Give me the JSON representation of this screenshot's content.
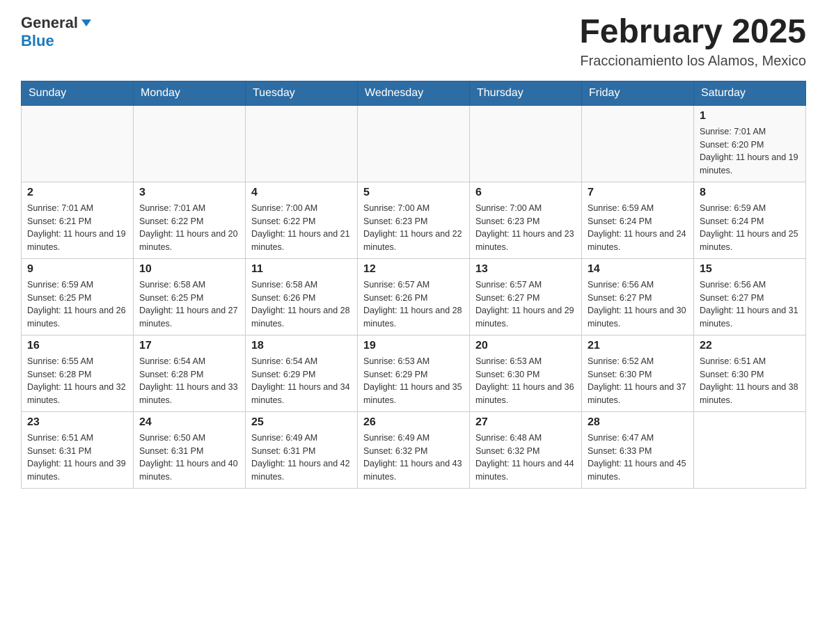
{
  "header": {
    "logo": {
      "general": "General",
      "blue": "Blue"
    },
    "title": "February 2025",
    "subtitle": "Fraccionamiento los Alamos, Mexico"
  },
  "days_of_week": [
    "Sunday",
    "Monday",
    "Tuesday",
    "Wednesday",
    "Thursday",
    "Friday",
    "Saturday"
  ],
  "weeks": [
    [
      {
        "day": "",
        "info": ""
      },
      {
        "day": "",
        "info": ""
      },
      {
        "day": "",
        "info": ""
      },
      {
        "day": "",
        "info": ""
      },
      {
        "day": "",
        "info": ""
      },
      {
        "day": "",
        "info": ""
      },
      {
        "day": "1",
        "info": "Sunrise: 7:01 AM\nSunset: 6:20 PM\nDaylight: 11 hours and 19 minutes."
      }
    ],
    [
      {
        "day": "2",
        "info": "Sunrise: 7:01 AM\nSunset: 6:21 PM\nDaylight: 11 hours and 19 minutes."
      },
      {
        "day": "3",
        "info": "Sunrise: 7:01 AM\nSunset: 6:22 PM\nDaylight: 11 hours and 20 minutes."
      },
      {
        "day": "4",
        "info": "Sunrise: 7:00 AM\nSunset: 6:22 PM\nDaylight: 11 hours and 21 minutes."
      },
      {
        "day": "5",
        "info": "Sunrise: 7:00 AM\nSunset: 6:23 PM\nDaylight: 11 hours and 22 minutes."
      },
      {
        "day": "6",
        "info": "Sunrise: 7:00 AM\nSunset: 6:23 PM\nDaylight: 11 hours and 23 minutes."
      },
      {
        "day": "7",
        "info": "Sunrise: 6:59 AM\nSunset: 6:24 PM\nDaylight: 11 hours and 24 minutes."
      },
      {
        "day": "8",
        "info": "Sunrise: 6:59 AM\nSunset: 6:24 PM\nDaylight: 11 hours and 25 minutes."
      }
    ],
    [
      {
        "day": "9",
        "info": "Sunrise: 6:59 AM\nSunset: 6:25 PM\nDaylight: 11 hours and 26 minutes."
      },
      {
        "day": "10",
        "info": "Sunrise: 6:58 AM\nSunset: 6:25 PM\nDaylight: 11 hours and 27 minutes."
      },
      {
        "day": "11",
        "info": "Sunrise: 6:58 AM\nSunset: 6:26 PM\nDaylight: 11 hours and 28 minutes."
      },
      {
        "day": "12",
        "info": "Sunrise: 6:57 AM\nSunset: 6:26 PM\nDaylight: 11 hours and 28 minutes."
      },
      {
        "day": "13",
        "info": "Sunrise: 6:57 AM\nSunset: 6:27 PM\nDaylight: 11 hours and 29 minutes."
      },
      {
        "day": "14",
        "info": "Sunrise: 6:56 AM\nSunset: 6:27 PM\nDaylight: 11 hours and 30 minutes."
      },
      {
        "day": "15",
        "info": "Sunrise: 6:56 AM\nSunset: 6:27 PM\nDaylight: 11 hours and 31 minutes."
      }
    ],
    [
      {
        "day": "16",
        "info": "Sunrise: 6:55 AM\nSunset: 6:28 PM\nDaylight: 11 hours and 32 minutes."
      },
      {
        "day": "17",
        "info": "Sunrise: 6:54 AM\nSunset: 6:28 PM\nDaylight: 11 hours and 33 minutes."
      },
      {
        "day": "18",
        "info": "Sunrise: 6:54 AM\nSunset: 6:29 PM\nDaylight: 11 hours and 34 minutes."
      },
      {
        "day": "19",
        "info": "Sunrise: 6:53 AM\nSunset: 6:29 PM\nDaylight: 11 hours and 35 minutes."
      },
      {
        "day": "20",
        "info": "Sunrise: 6:53 AM\nSunset: 6:30 PM\nDaylight: 11 hours and 36 minutes."
      },
      {
        "day": "21",
        "info": "Sunrise: 6:52 AM\nSunset: 6:30 PM\nDaylight: 11 hours and 37 minutes."
      },
      {
        "day": "22",
        "info": "Sunrise: 6:51 AM\nSunset: 6:30 PM\nDaylight: 11 hours and 38 minutes."
      }
    ],
    [
      {
        "day": "23",
        "info": "Sunrise: 6:51 AM\nSunset: 6:31 PM\nDaylight: 11 hours and 39 minutes."
      },
      {
        "day": "24",
        "info": "Sunrise: 6:50 AM\nSunset: 6:31 PM\nDaylight: 11 hours and 40 minutes."
      },
      {
        "day": "25",
        "info": "Sunrise: 6:49 AM\nSunset: 6:31 PM\nDaylight: 11 hours and 42 minutes."
      },
      {
        "day": "26",
        "info": "Sunrise: 6:49 AM\nSunset: 6:32 PM\nDaylight: 11 hours and 43 minutes."
      },
      {
        "day": "27",
        "info": "Sunrise: 6:48 AM\nSunset: 6:32 PM\nDaylight: 11 hours and 44 minutes."
      },
      {
        "day": "28",
        "info": "Sunrise: 6:47 AM\nSunset: 6:33 PM\nDaylight: 11 hours and 45 minutes."
      },
      {
        "day": "",
        "info": ""
      }
    ]
  ]
}
